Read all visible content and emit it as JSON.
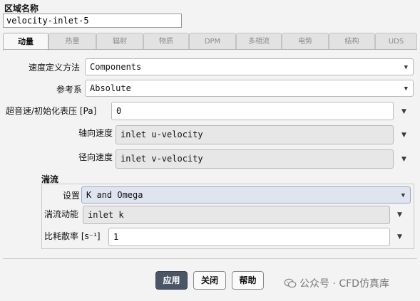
{
  "zone": {
    "label": "区域名称",
    "name_value": "velocity-inlet-5"
  },
  "tabs": [
    {
      "label": "动量",
      "active": true
    },
    {
      "label": "热量",
      "active": false
    },
    {
      "label": "辐射",
      "active": false
    },
    {
      "label": "物质",
      "active": false
    },
    {
      "label": "DPM",
      "active": false
    },
    {
      "label": "多相流",
      "active": false
    },
    {
      "label": "电势",
      "active": false
    },
    {
      "label": "结构",
      "active": false
    },
    {
      "label": "UDS",
      "active": false
    }
  ],
  "momentum": {
    "velocity_method": {
      "label": "速度定义方法",
      "value": "Components"
    },
    "reference_frame": {
      "label": "参考系",
      "value": "Absolute"
    },
    "gauge_pressure": {
      "label": "超音速/初始化表压 [Pa]",
      "value": "0"
    },
    "axial_velocity": {
      "label": "轴向速度",
      "value": "inlet u-velocity"
    },
    "radial_velocity": {
      "label": "径向速度",
      "value": "inlet v-velocity"
    }
  },
  "turbulence": {
    "section_title": "湍流",
    "spec": {
      "label": "设置",
      "value": "K and Omega"
    },
    "tke": {
      "label": "湍流动能",
      "value": "inlet k"
    },
    "sdr": {
      "label": "比耗散率 [s⁻¹]",
      "value": "1"
    }
  },
  "buttons": {
    "apply": "应用",
    "close": "关闭",
    "help": "帮助"
  },
  "watermark": "公众号 · CFD仿真库",
  "icons": {
    "dropdown": "chevron-down-icon",
    "watermark": "wechat-icon"
  },
  "colors": {
    "primary_button": "#4a5566",
    "selected_field": "#dfe4ef"
  }
}
